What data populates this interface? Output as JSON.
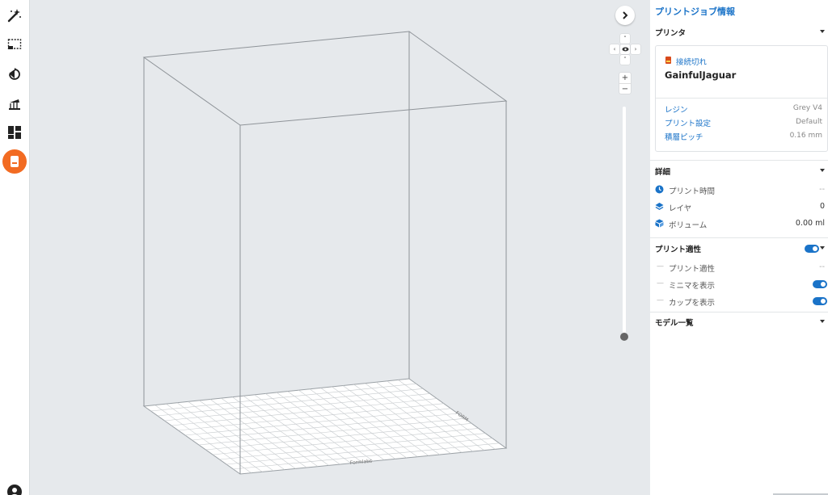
{
  "toolbar": {
    "tools": [
      {
        "name": "magic-wand-icon"
      },
      {
        "name": "selection-icon"
      },
      {
        "name": "orient-icon"
      },
      {
        "name": "supports-icon"
      },
      {
        "name": "layout-icon"
      },
      {
        "name": "printer-icon",
        "active": true,
        "accent": "#f26b22"
      }
    ],
    "account_icon": "account-icon"
  },
  "viewport": {
    "expand_icon": "chevron-right-icon",
    "pan": {
      "up": "˄",
      "down": "˅",
      "left": "‹",
      "right": "›",
      "center": "eye-icon"
    },
    "zoom": {
      "in": "+",
      "out": "−"
    },
    "build_plate_labels": {
      "front": "Formlabs",
      "side": "FORM"
    },
    "layer_slider_value": 0
  },
  "panel": {
    "title": "プリントジョブ情報",
    "accent_color": "#1a73c8",
    "printer_section": {
      "label": "プリンタ",
      "status": "接続切れ",
      "status_color": "#d84a1b",
      "printer_name": "GainfulJaguar",
      "resin_label": "レジン",
      "resin_value": "Grey V4",
      "print_settings_label": "プリント設定",
      "print_settings_value": "Default",
      "layer_pitch_label": "積層ピッチ",
      "layer_pitch_value": "0.16 mm"
    },
    "details_section": {
      "label": "詳細",
      "rows": [
        {
          "icon": "clock-icon",
          "label": "プリント時間",
          "value": "--"
        },
        {
          "icon": "layers-icon",
          "label": "レイヤ",
          "value": "0"
        },
        {
          "icon": "volume-icon",
          "label": "ボリューム",
          "value": "0.00 ml"
        }
      ]
    },
    "printability_section": {
      "label": "プリント適性",
      "toggle_on": true,
      "rows": [
        {
          "label": "プリント適性",
          "value": "--"
        },
        {
          "label": "ミニマを表示",
          "toggle_on": true
        },
        {
          "label": "カップを表示",
          "toggle_on": true
        }
      ]
    },
    "models_section": {
      "label": "モデル一覧"
    }
  }
}
